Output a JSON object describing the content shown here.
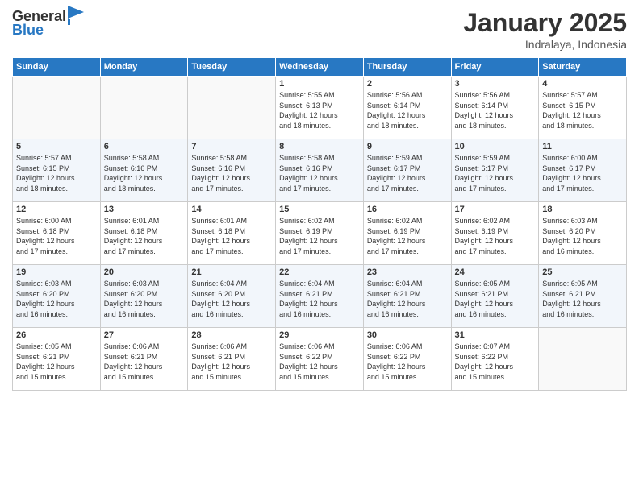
{
  "logo": {
    "line1": "General",
    "line2": "Blue"
  },
  "title": "January 2025",
  "subtitle": "Indralaya, Indonesia",
  "days_header": [
    "Sunday",
    "Monday",
    "Tuesday",
    "Wednesday",
    "Thursday",
    "Friday",
    "Saturday"
  ],
  "weeks": [
    [
      {
        "day": "",
        "info": ""
      },
      {
        "day": "",
        "info": ""
      },
      {
        "day": "",
        "info": ""
      },
      {
        "day": "1",
        "info": "Sunrise: 5:55 AM\nSunset: 6:13 PM\nDaylight: 12 hours\nand 18 minutes."
      },
      {
        "day": "2",
        "info": "Sunrise: 5:56 AM\nSunset: 6:14 PM\nDaylight: 12 hours\nand 18 minutes."
      },
      {
        "day": "3",
        "info": "Sunrise: 5:56 AM\nSunset: 6:14 PM\nDaylight: 12 hours\nand 18 minutes."
      },
      {
        "day": "4",
        "info": "Sunrise: 5:57 AM\nSunset: 6:15 PM\nDaylight: 12 hours\nand 18 minutes."
      }
    ],
    [
      {
        "day": "5",
        "info": "Sunrise: 5:57 AM\nSunset: 6:15 PM\nDaylight: 12 hours\nand 18 minutes."
      },
      {
        "day": "6",
        "info": "Sunrise: 5:58 AM\nSunset: 6:16 PM\nDaylight: 12 hours\nand 18 minutes."
      },
      {
        "day": "7",
        "info": "Sunrise: 5:58 AM\nSunset: 6:16 PM\nDaylight: 12 hours\nand 17 minutes."
      },
      {
        "day": "8",
        "info": "Sunrise: 5:58 AM\nSunset: 6:16 PM\nDaylight: 12 hours\nand 17 minutes."
      },
      {
        "day": "9",
        "info": "Sunrise: 5:59 AM\nSunset: 6:17 PM\nDaylight: 12 hours\nand 17 minutes."
      },
      {
        "day": "10",
        "info": "Sunrise: 5:59 AM\nSunset: 6:17 PM\nDaylight: 12 hours\nand 17 minutes."
      },
      {
        "day": "11",
        "info": "Sunrise: 6:00 AM\nSunset: 6:17 PM\nDaylight: 12 hours\nand 17 minutes."
      }
    ],
    [
      {
        "day": "12",
        "info": "Sunrise: 6:00 AM\nSunset: 6:18 PM\nDaylight: 12 hours\nand 17 minutes."
      },
      {
        "day": "13",
        "info": "Sunrise: 6:01 AM\nSunset: 6:18 PM\nDaylight: 12 hours\nand 17 minutes."
      },
      {
        "day": "14",
        "info": "Sunrise: 6:01 AM\nSunset: 6:18 PM\nDaylight: 12 hours\nand 17 minutes."
      },
      {
        "day": "15",
        "info": "Sunrise: 6:02 AM\nSunset: 6:19 PM\nDaylight: 12 hours\nand 17 minutes."
      },
      {
        "day": "16",
        "info": "Sunrise: 6:02 AM\nSunset: 6:19 PM\nDaylight: 12 hours\nand 17 minutes."
      },
      {
        "day": "17",
        "info": "Sunrise: 6:02 AM\nSunset: 6:19 PM\nDaylight: 12 hours\nand 17 minutes."
      },
      {
        "day": "18",
        "info": "Sunrise: 6:03 AM\nSunset: 6:20 PM\nDaylight: 12 hours\nand 16 minutes."
      }
    ],
    [
      {
        "day": "19",
        "info": "Sunrise: 6:03 AM\nSunset: 6:20 PM\nDaylight: 12 hours\nand 16 minutes."
      },
      {
        "day": "20",
        "info": "Sunrise: 6:03 AM\nSunset: 6:20 PM\nDaylight: 12 hours\nand 16 minutes."
      },
      {
        "day": "21",
        "info": "Sunrise: 6:04 AM\nSunset: 6:20 PM\nDaylight: 12 hours\nand 16 minutes."
      },
      {
        "day": "22",
        "info": "Sunrise: 6:04 AM\nSunset: 6:21 PM\nDaylight: 12 hours\nand 16 minutes."
      },
      {
        "day": "23",
        "info": "Sunrise: 6:04 AM\nSunset: 6:21 PM\nDaylight: 12 hours\nand 16 minutes."
      },
      {
        "day": "24",
        "info": "Sunrise: 6:05 AM\nSunset: 6:21 PM\nDaylight: 12 hours\nand 16 minutes."
      },
      {
        "day": "25",
        "info": "Sunrise: 6:05 AM\nSunset: 6:21 PM\nDaylight: 12 hours\nand 16 minutes."
      }
    ],
    [
      {
        "day": "26",
        "info": "Sunrise: 6:05 AM\nSunset: 6:21 PM\nDaylight: 12 hours\nand 15 minutes."
      },
      {
        "day": "27",
        "info": "Sunrise: 6:06 AM\nSunset: 6:21 PM\nDaylight: 12 hours\nand 15 minutes."
      },
      {
        "day": "28",
        "info": "Sunrise: 6:06 AM\nSunset: 6:21 PM\nDaylight: 12 hours\nand 15 minutes."
      },
      {
        "day": "29",
        "info": "Sunrise: 6:06 AM\nSunset: 6:22 PM\nDaylight: 12 hours\nand 15 minutes."
      },
      {
        "day": "30",
        "info": "Sunrise: 6:06 AM\nSunset: 6:22 PM\nDaylight: 12 hours\nand 15 minutes."
      },
      {
        "day": "31",
        "info": "Sunrise: 6:07 AM\nSunset: 6:22 PM\nDaylight: 12 hours\nand 15 minutes."
      },
      {
        "day": "",
        "info": ""
      }
    ]
  ]
}
